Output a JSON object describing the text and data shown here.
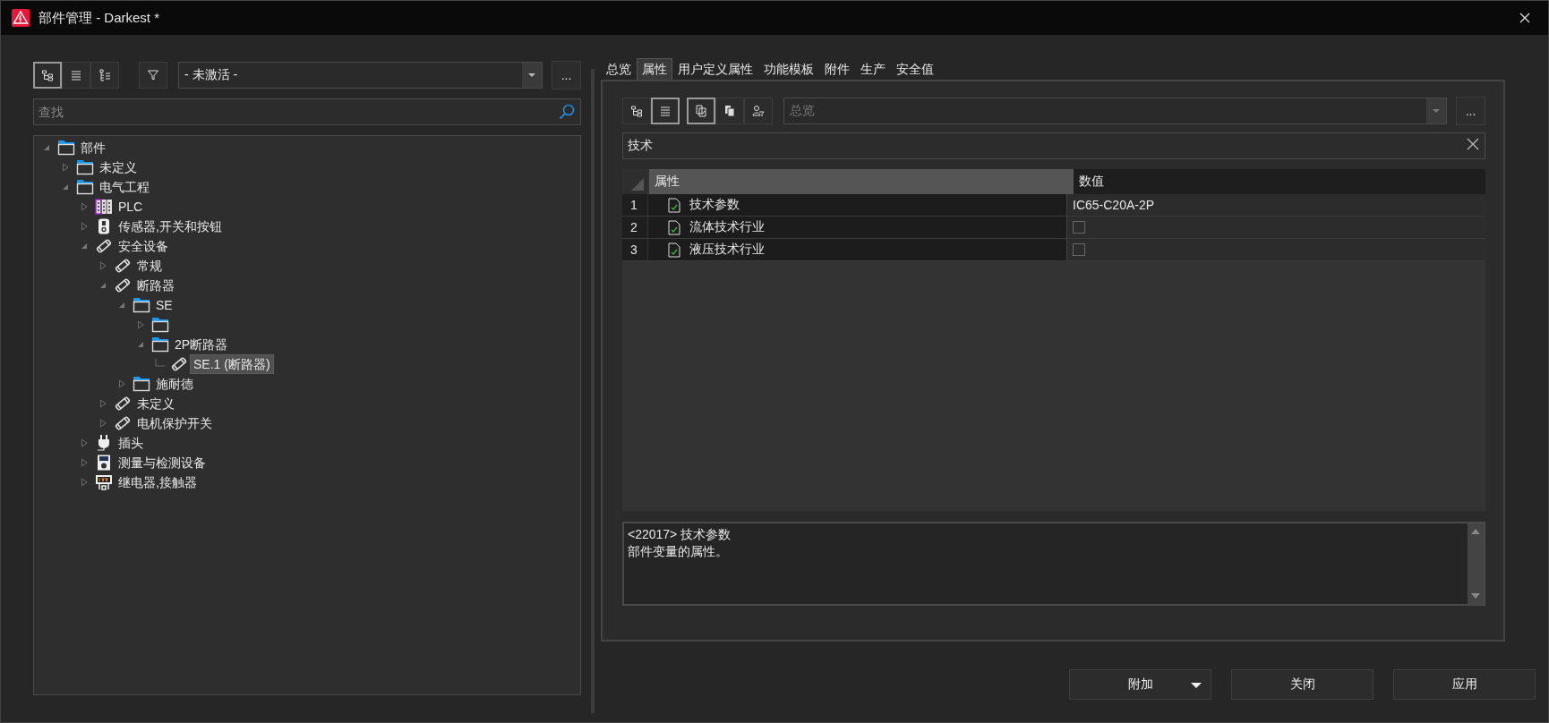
{
  "window": {
    "title": "部件管理 - Darkest *"
  },
  "left_toolbar": {
    "view_buttons": [
      {
        "kind": "tree",
        "selected": true
      },
      {
        "kind": "list",
        "selected": false
      },
      {
        "kind": "tree-list",
        "selected": false
      }
    ],
    "filter_dropdown": {
      "value": "- 未激活 -"
    },
    "more_button": "..."
  },
  "search": {
    "placeholder": "查找"
  },
  "tree": [
    {
      "label": "部件",
      "kind": "folder",
      "expanded": true,
      "selected": false,
      "children": [
        {
          "label": "未定义",
          "kind": "folder",
          "expanded": false,
          "selected": false
        },
        {
          "label": "电气工程",
          "kind": "folder",
          "expanded": true,
          "selected": false,
          "children": [
            {
              "label": "PLC",
              "kind": "plc",
              "expanded": false,
              "selected": false
            },
            {
              "label": "传感器,开关和按钮",
              "kind": "sensor",
              "expanded": false,
              "selected": false
            },
            {
              "label": "安全设备",
              "kind": "fuse",
              "expanded": true,
              "selected": false,
              "children": [
                {
                  "label": "常规",
                  "kind": "fuse",
                  "expanded": false,
                  "selected": false
                },
                {
                  "label": "断路器",
                  "kind": "fuse",
                  "expanded": true,
                  "selected": false,
                  "children": [
                    {
                      "label": "SE",
                      "kind": "folder",
                      "expanded": true,
                      "selected": false,
                      "children": [
                        {
                          "kind": "folder",
                          "expanded": false,
                          "selected": false
                        },
                        {
                          "label": "2P断路器",
                          "kind": "folder",
                          "expanded": true,
                          "selected": false,
                          "children": [
                            {
                              "label": "SE.1 (断路器)",
                              "kind": "fuse",
                              "selected": true
                            }
                          ]
                        }
                      ]
                    },
                    {
                      "label": "施耐德",
                      "kind": "folder",
                      "expanded": false,
                      "selected": false
                    }
                  ]
                },
                {
                  "label": "未定义",
                  "kind": "fuse",
                  "expanded": false,
                  "selected": false
                },
                {
                  "label": "电机保护开关",
                  "kind": "fuse",
                  "expanded": false,
                  "selected": false
                }
              ]
            },
            {
              "label": "插头",
              "kind": "plug",
              "expanded": false,
              "selected": false
            },
            {
              "label": "测量与检测设备",
              "kind": "meter",
              "expanded": false,
              "selected": false
            },
            {
              "label": "继电器,接触器",
              "kind": "relay",
              "expanded": false,
              "selected": false
            }
          ]
        }
      ]
    }
  ],
  "tabs": [
    {
      "label": "总览",
      "selected": false
    },
    {
      "label": "属性",
      "selected": true
    },
    {
      "label": "用户定义属性",
      "selected": false
    },
    {
      "label": "功能模板",
      "selected": false
    },
    {
      "label": "附件",
      "selected": false
    },
    {
      "label": "生产",
      "selected": false
    },
    {
      "label": "安全值",
      "selected": false
    }
  ],
  "right_toolbar": {
    "buttons": [
      {
        "kind": "tree",
        "selected": false
      },
      {
        "kind": "list",
        "selected": true
      },
      {
        "kind": "copy",
        "selected": true
      },
      {
        "kind": "paste",
        "selected": false
      },
      {
        "kind": "user-filter",
        "selected": false
      }
    ],
    "view_dropdown": {
      "value": "总览",
      "disabled": true
    },
    "more_button": "..."
  },
  "property_filter": {
    "value": "技术"
  },
  "table": {
    "columns": [
      "属性",
      "数值"
    ],
    "rows": [
      {
        "index": "1",
        "property": "技术参数",
        "kind": "text",
        "value": "IC65-C20A-2P"
      },
      {
        "index": "2",
        "property": "流体技术行业",
        "kind": "checkbox",
        "checked": false
      },
      {
        "index": "3",
        "property": "液压技术行业",
        "kind": "checkbox",
        "checked": false
      }
    ]
  },
  "description": {
    "lines": [
      "<22017> 技术参数",
      "部件变量的属性。"
    ]
  },
  "buttons": [
    {
      "label": "附加",
      "kind": "split"
    },
    {
      "label": "关闭",
      "kind": "plain"
    },
    {
      "label": "应用",
      "kind": "plain"
    }
  ]
}
